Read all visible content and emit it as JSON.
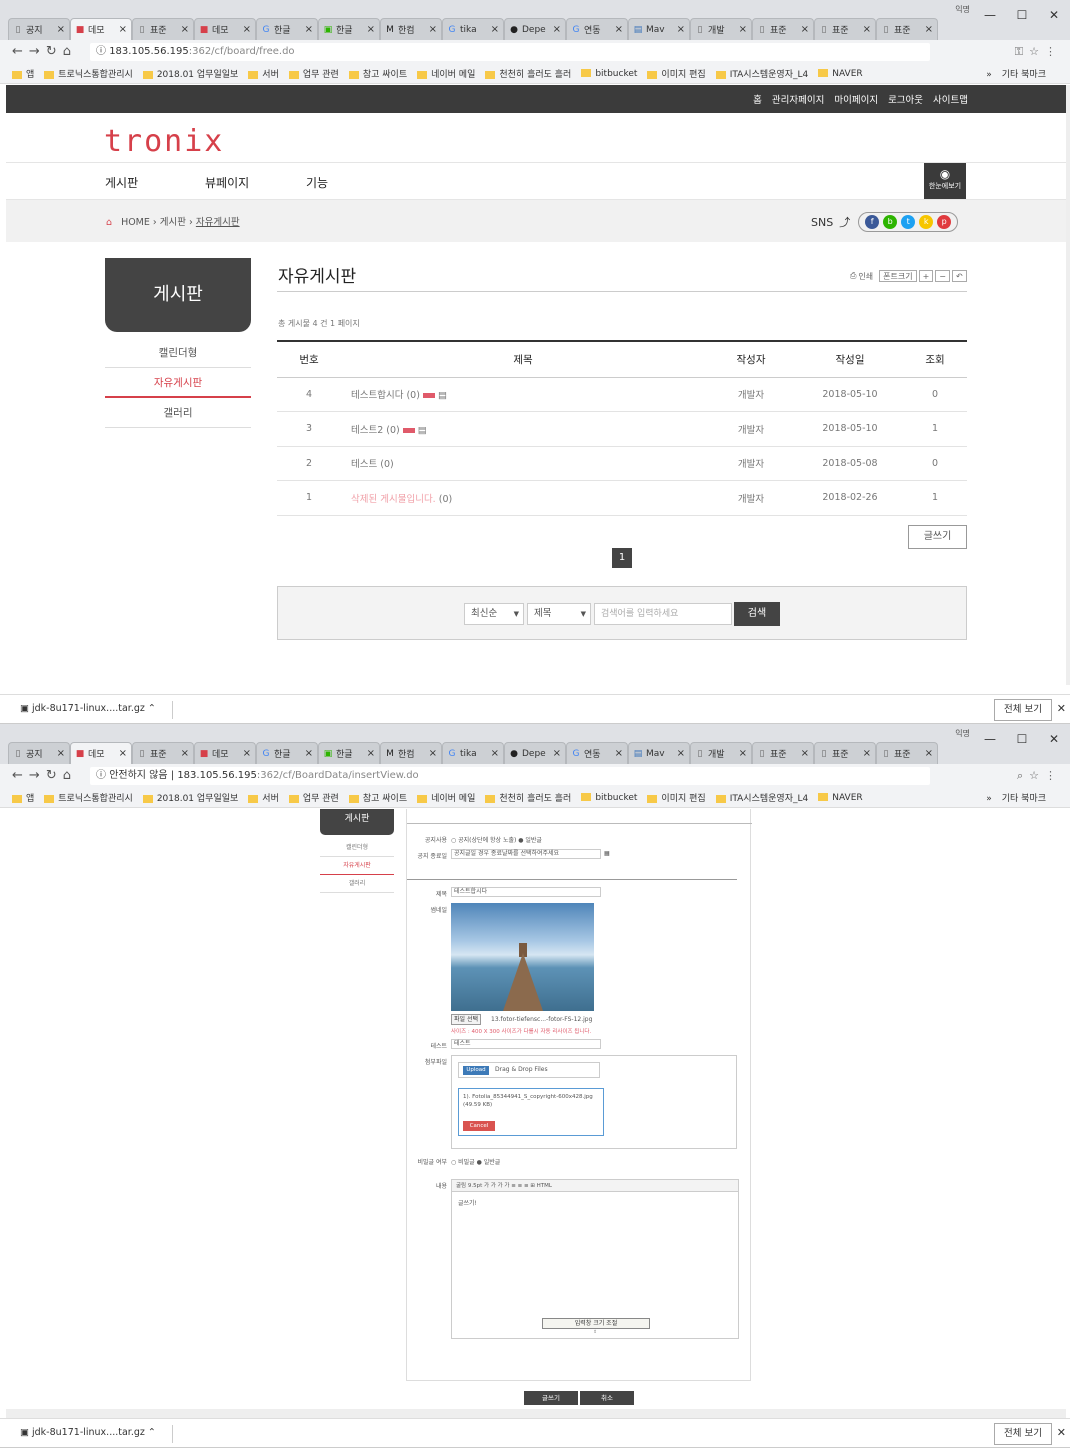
{
  "tabs": [
    {
      "icon": "page",
      "label": "공지"
    },
    {
      "icon": "red",
      "label": "데모",
      "active": true
    },
    {
      "icon": "page",
      "label": "표준"
    },
    {
      "icon": "red",
      "label": "데모"
    },
    {
      "icon": "g",
      "label": "한글"
    },
    {
      "icon": "green",
      "label": "한글"
    },
    {
      "icon": "m",
      "label": "한컴"
    },
    {
      "icon": "g",
      "label": "tika"
    },
    {
      "icon": "gh",
      "label": "Depe"
    },
    {
      "icon": "g",
      "label": "연동"
    },
    {
      "icon": "mvn",
      "label": "Mav"
    },
    {
      "icon": "page",
      "label": "개발"
    },
    {
      "icon": "page",
      "label": "표준"
    },
    {
      "icon": "page",
      "label": "표준"
    },
    {
      "icon": "page",
      "label": "표준"
    }
  ],
  "profile": "익명",
  "window_controls": [
    "—",
    "☐",
    "✕"
  ],
  "w1": {
    "url_host": "183.105.56.195",
    "url_path": ":362/cf/board/free.do"
  },
  "w2": {
    "insecure": "안전하지 않음",
    "url_host": "183.105.56.195",
    "url_path": ":362/cf/BoardData/insertView.do"
  },
  "bookmarks": [
    "앱",
    "트로닉스통합관리시",
    "2018.01 업무일일보",
    "서버",
    "업무 관련",
    "참고 싸이트",
    "네이버 메일",
    "천천히 흘러도 흘러",
    "bitbucket",
    "이미지 편집",
    "ITA시스템운영자_L4",
    "NAVER"
  ],
  "bookmark_more": "»",
  "bookmark_other": "기타 북마크",
  "util_links": [
    "홈",
    "관리자페이지",
    "마이페이지",
    "로그아웃",
    "사이트맵"
  ],
  "logo": "tronix",
  "gnb": [
    "게시판",
    "뷰페이지",
    "기능"
  ],
  "eye_label": "한눈에보기",
  "breadcrumb": {
    "home": "HOME",
    "sep": "›",
    "b1": "게시판",
    "b2": "자유게시판"
  },
  "sns_label": "SNS",
  "side": {
    "title": "게시판",
    "items": [
      "캘린더형",
      "자유게시판",
      "갤러리"
    ]
  },
  "page_title": "자유게시판",
  "tools": {
    "print": "인쇄",
    "font": "폰트크기",
    "plus": "+",
    "minus": "−",
    "reset": "↶"
  },
  "total": "총 게시물 4 건 1 페이지",
  "table": {
    "headers": [
      "번호",
      "제목",
      "작성자",
      "작성일",
      "조회"
    ],
    "rows": [
      {
        "no": "4",
        "title": "테스트합시다 (0)",
        "author": "개발자",
        "date": "2018-05-10",
        "views": "0"
      },
      {
        "no": "3",
        "title": "테스트2 (0)",
        "author": "개발자",
        "date": "2018-05-10",
        "views": "1"
      },
      {
        "no": "2",
        "title": "테스트 (0)",
        "author": "개발자",
        "date": "2018-05-08",
        "views": "0"
      },
      {
        "no": "1",
        "title": "삭제된 게시물입니다.",
        "title_suffix": "(0)",
        "author": "개발자",
        "date": "2018-02-26",
        "views": "1"
      }
    ]
  },
  "write_btn": "글쓰기",
  "page": "1",
  "search": {
    "order": "최신순",
    "field": "제목",
    "placeholder": "검색어를 입력하세요",
    "button": "검색"
  },
  "download": {
    "file": "jdk-8u171-linux....tar.gz",
    "show_all": "전체 보기"
  },
  "form": {
    "side_title": "게시판",
    "side_items": [
      "캘린더형",
      "자유게시판",
      "갤러리"
    ],
    "notice_label": "공지사용",
    "notice_opts": "○ 공지(상단에 항상 노출)  ● 일반글",
    "notice_end_label": "공지 종료일",
    "notice_end_ph": "공지글일 경우 종료날짜를 선택하여주세요",
    "subject_label": "제목",
    "subject_value": "테스트합시다",
    "thumb_label": "썸네일",
    "file_btn": "파일 선택",
    "file_name": "13.fotor-tiefensc...-fotor-FS-12.jpg",
    "size_note": "사이즈 : 400 X 300 사이즈가 다를시 자동 리사이즈 됩니다.",
    "test_label": "테스트",
    "test_value": "테스트",
    "attach_label": "첨부파일",
    "upload_btn": "Upload",
    "drag_text": "Drag & Drop Files",
    "attach_file": "1). Fotolia_85344941_S_copyright-600x428.jpg (49.59 KB)",
    "cancel_btn": "Cancel",
    "secret_label": "비밀글 여부",
    "secret_opts": "○ 비밀글  ● 일반글",
    "content_label": "내용",
    "editor_toolbar": "굴림  9.5pt  가 가 가 가  ≡ ≡ ≡  ⊞  HTML",
    "editor_text": "글쓰기!",
    "editor_tip": "입력창 크기 조절",
    "submit": "글쓰기",
    "cancel": "취소"
  },
  "colors": {
    "accent": "#d6404a",
    "dark": "#3b3b3b"
  }
}
